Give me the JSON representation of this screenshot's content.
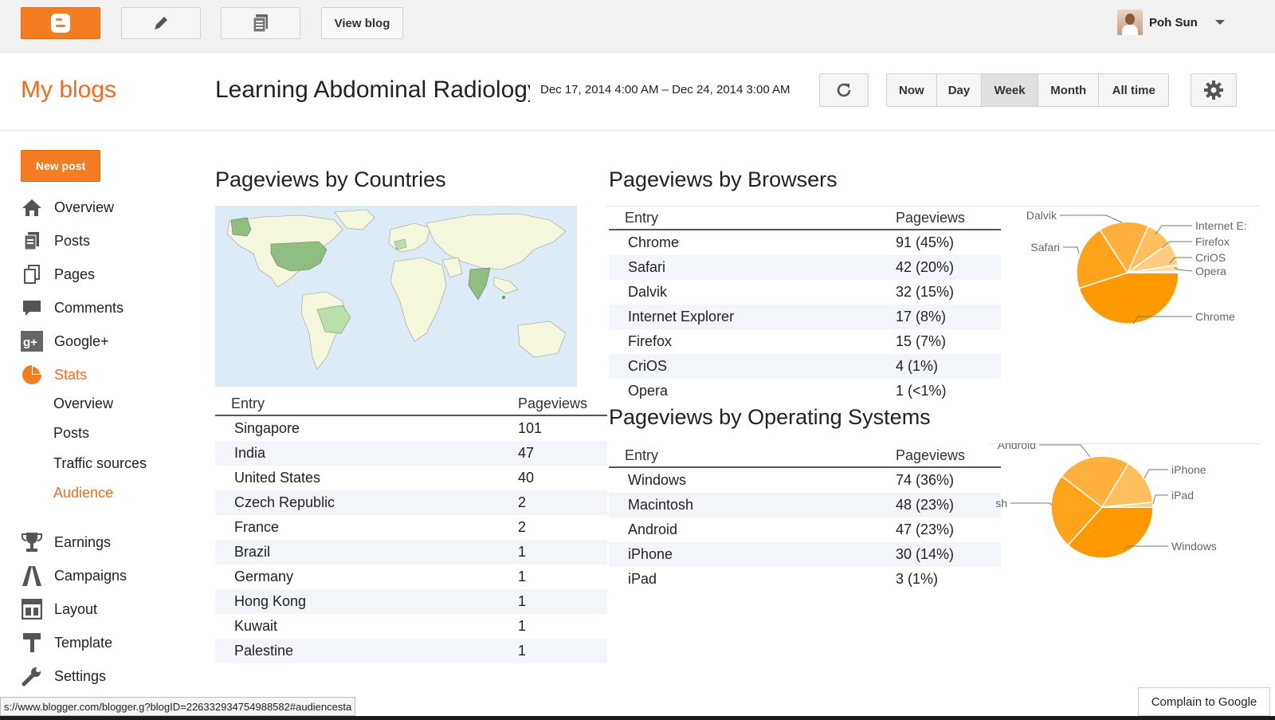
{
  "topbar": {
    "view_blog": "View blog",
    "user_name": "Poh Sun"
  },
  "header": {
    "my_blogs": "My blogs",
    "blog_title": "Learning Abdominal Radiology",
    "date_range": "Dec 17, 2014 4:00 AM – Dec 24, 2014 3:00 AM",
    "ranges": [
      "Now",
      "Day",
      "Week",
      "Month",
      "All time"
    ],
    "active_range": "Week"
  },
  "sidebar": {
    "new_post": "New post",
    "items": [
      {
        "label": "Overview",
        "icon": "home-icon"
      },
      {
        "label": "Posts",
        "icon": "posts-icon"
      },
      {
        "label": "Pages",
        "icon": "pages-icon"
      },
      {
        "label": "Comments",
        "icon": "comments-icon"
      },
      {
        "label": "Google+",
        "icon": "google-plus-icon"
      },
      {
        "label": "Stats",
        "icon": "stats-icon"
      }
    ],
    "stats_sub": [
      "Overview",
      "Posts",
      "Traffic sources",
      "Audience"
    ],
    "items2": [
      {
        "label": "Earnings",
        "icon": "trophy-icon"
      },
      {
        "label": "Campaigns",
        "icon": "campaigns-icon"
      },
      {
        "label": "Layout",
        "icon": "layout-icon"
      },
      {
        "label": "Template",
        "icon": "template-icon"
      },
      {
        "label": "Settings",
        "icon": "wrench-icon"
      }
    ]
  },
  "countries": {
    "title": "Pageviews by Countries",
    "col_entry": "Entry",
    "col_pageviews": "Pageviews",
    "rows": [
      [
        "Singapore",
        "101"
      ],
      [
        "India",
        "47"
      ],
      [
        "United States",
        "40"
      ],
      [
        "Czech Republic",
        "2"
      ],
      [
        "France",
        "2"
      ],
      [
        "Brazil",
        "1"
      ],
      [
        "Germany",
        "1"
      ],
      [
        "Hong Kong",
        "1"
      ],
      [
        "Kuwait",
        "1"
      ],
      [
        "Palestine",
        "1"
      ]
    ]
  },
  "browsers": {
    "title": "Pageviews by Browsers",
    "col_entry": "Entry",
    "col_pageviews": "Pageviews",
    "rows": [
      [
        "Chrome",
        "91 (45%)"
      ],
      [
        "Safari",
        "42 (20%)"
      ],
      [
        "Dalvik",
        "32 (15%)"
      ],
      [
        "Internet Explorer",
        "17 (8%)"
      ],
      [
        "Firefox",
        "15 (7%)"
      ],
      [
        "CriOS",
        "4 (1%)"
      ],
      [
        "Opera",
        "1 (<1%)"
      ]
    ],
    "pie_labels": [
      "Dalvik",
      "Internet E:",
      "Firefox",
      "Safari",
      "CriOS",
      "Opera",
      "Chrome"
    ]
  },
  "os": {
    "title": "Pageviews by Operating Systems",
    "col_entry": "Entry",
    "col_pageviews": "Pageviews",
    "rows": [
      [
        "Windows",
        "74 (36%)"
      ],
      [
        "Macintosh",
        "48 (23%)"
      ],
      [
        "Android",
        "47 (23%)"
      ],
      [
        "iPhone",
        "30 (14%)"
      ],
      [
        "iPad",
        "3 (1%)"
      ]
    ],
    "pie_labels": [
      "Android",
      "iPhone",
      "Macintosh",
      "iPad",
      "Windows"
    ]
  },
  "chart_data": [
    {
      "type": "pie",
      "categories": [
        "Chrome",
        "Safari",
        "Dalvik",
        "Internet Explorer",
        "Firefox",
        "CriOS",
        "Opera"
      ],
      "values": [
        91,
        42,
        32,
        17,
        15,
        4,
        1
      ]
    },
    {
      "type": "pie",
      "categories": [
        "Windows",
        "Macintosh",
        "Android",
        "iPhone",
        "iPad"
      ],
      "values": [
        74,
        48,
        47,
        30,
        3
      ]
    }
  ],
  "colors": {
    "accent": "#f57d21",
    "pie": [
      "#ff9900",
      "#ffa31a",
      "#ffb03d",
      "#ffbf5e",
      "#ffcd80",
      "#ffdba3",
      "#ffe9c6"
    ]
  },
  "status_url": "s://www.blogger.com/blogger.g?blogID=226332934754988582#audiencesta",
  "complain": "Complain to Google"
}
